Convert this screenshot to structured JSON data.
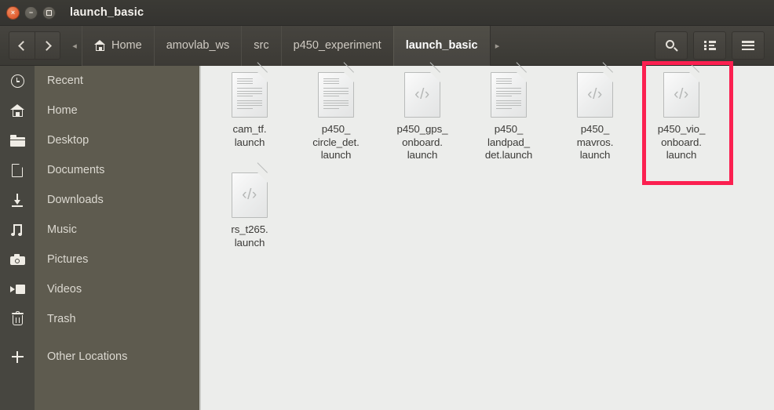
{
  "window": {
    "title": "launch_basic",
    "controls": [
      {
        "name": "close",
        "glyph": "×"
      },
      {
        "name": "minimize",
        "glyph": "−"
      },
      {
        "name": "maximize",
        "glyph": "□"
      }
    ]
  },
  "toolbar": {
    "back_label": "Back",
    "forward_label": "Forward",
    "overflow_left": "◂",
    "overflow_right": "▸",
    "breadcrumbs": [
      {
        "label": "Home",
        "icon": "home-icon",
        "active": false
      },
      {
        "label": "amovlab_ws",
        "icon": null,
        "active": false
      },
      {
        "label": "src",
        "icon": null,
        "active": false
      },
      {
        "label": "p450_experiment",
        "icon": null,
        "active": false
      },
      {
        "label": "launch_basic",
        "icon": null,
        "active": true
      }
    ],
    "actions": [
      {
        "name": "search-button",
        "icon": "search-icon"
      },
      {
        "name": "view-options-button",
        "icon": "list-view-icon"
      },
      {
        "name": "menu-button",
        "icon": "hamburger-menu-icon"
      }
    ]
  },
  "sidebar": {
    "items": [
      {
        "label": "Recent",
        "icon": "clock-icon"
      },
      {
        "label": "Home",
        "icon": "home-icon"
      },
      {
        "label": "Desktop",
        "icon": "folder-icon"
      },
      {
        "label": "Documents",
        "icon": "document-icon"
      },
      {
        "label": "Downloads",
        "icon": "download-icon"
      },
      {
        "label": "Music",
        "icon": "music-icon"
      },
      {
        "label": "Pictures",
        "icon": "camera-icon"
      },
      {
        "label": "Videos",
        "icon": "video-icon"
      },
      {
        "label": "Trash",
        "icon": "trash-icon"
      },
      {
        "label": "Other Locations",
        "icon": "plus-icon"
      }
    ]
  },
  "files": [
    {
      "name": "cam_tf.\nlaunch",
      "icon": "text-document-icon",
      "selected": false,
      "highlighted": false
    },
    {
      "name": "p450_\ncircle_det.\nlaunch",
      "icon": "text-document-icon",
      "selected": false,
      "highlighted": false
    },
    {
      "name": "p450_gps_\nonboard.\nlaunch",
      "icon": "xml-document-icon",
      "selected": false,
      "highlighted": false
    },
    {
      "name": "p450_\nlandpad_\ndet.launch",
      "icon": "text-document-icon",
      "selected": false,
      "highlighted": false
    },
    {
      "name": "p450_\nmavros.\nlaunch",
      "icon": "xml-document-icon",
      "selected": false,
      "highlighted": false
    },
    {
      "name": "p450_vio_\nonboard.\nlaunch",
      "icon": "xml-document-icon",
      "selected": false,
      "highlighted": true
    },
    {
      "name": "rs_t265.\nlaunch",
      "icon": "xml-document-icon",
      "selected": false,
      "highlighted": false
    }
  ],
  "annotation": {
    "highlight_color": "#FB2050",
    "target_file": "p450_vio_onboard.launch"
  },
  "colors": {
    "titlebar_bg": "#3A3934",
    "toolbar_bg": "#41403B",
    "sidebar_bg": "#5E5B4F",
    "sidebar_strip_bg": "#474640",
    "content_bg": "#ECEDEB",
    "text_light": "#DCD9D1",
    "text_dark": "#3C3B38",
    "accent_red": "#FB2050"
  },
  "xml_glyph": "‹/›"
}
